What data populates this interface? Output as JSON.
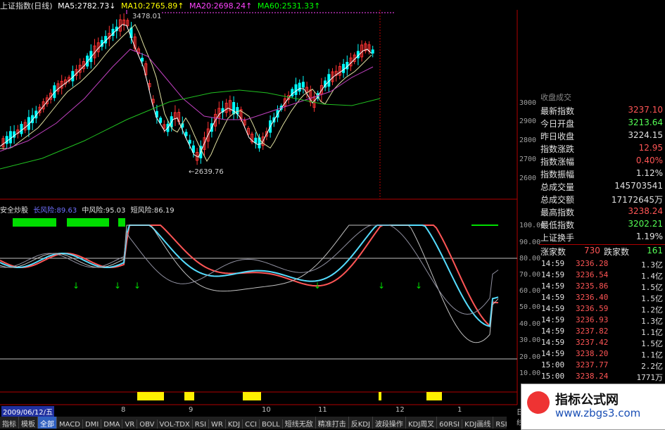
{
  "top_header": {
    "index_name": "上证指数(日线)",
    "ma5": "MA5:2782.73↓",
    "ma10": "MA10:2765.89↑",
    "ma20": "MA20:2698.24↑",
    "ma60": "MA60:2531.33↑"
  },
  "price_axis": [
    "3000",
    "2900",
    "2800",
    "2700",
    "2600"
  ],
  "annotations": {
    "high": "3478.01",
    "low": "←2639.76"
  },
  "mid_header": {
    "name": "安全炒股",
    "long_risk": "长风险:89.63",
    "mid_risk": "中风险:95.03",
    "short_risk": "短风险:86.19"
  },
  "osc_axis": [
    "100.00",
    "90.00",
    "80.00",
    "70.00",
    "60.00",
    "50.00",
    "40.00",
    "30.00",
    "20.00",
    "10.00"
  ],
  "quote": {
    "top_partial": "收盘成交",
    "rows": [
      {
        "label": "最新指数",
        "value": "3237.10",
        "color": "#ff5555"
      },
      {
        "label": "今日开盘",
        "value": "3213.64",
        "color": "#55ff55"
      },
      {
        "label": "昨日收盘",
        "value": "3224.15",
        "color": "#e0e0e0"
      },
      {
        "label": "指数涨跌",
        "value": "12.95",
        "color": "#ff5555"
      },
      {
        "label": "指数涨幅",
        "value": "0.40%",
        "color": "#ff5555"
      },
      {
        "label": "指数振幅",
        "value": "1.12%",
        "color": "#e0e0e0"
      },
      {
        "label": "总成交量",
        "value": "145703541",
        "color": "#e0e0e0"
      },
      {
        "label": "总成交额",
        "value": "17172645万",
        "color": "#e0e0e0"
      },
      {
        "label": "最高指数",
        "value": "3238.24",
        "color": "#ff5555"
      },
      {
        "label": "最低指数",
        "value": "3202.21",
        "color": "#55ff55"
      },
      {
        "label": "上证换手",
        "value": "1.19%",
        "color": "#e0e0e0"
      }
    ],
    "breadth": {
      "up_label": "涨家数",
      "up": "730",
      "down_label": "跌家数",
      "down": "161"
    },
    "ticks": [
      {
        "time": "14:59",
        "price": "3236.28",
        "vol": "1.3亿"
      },
      {
        "time": "14:59",
        "price": "3236.54",
        "vol": "1.4亿"
      },
      {
        "time": "14:59",
        "price": "3235.86",
        "vol": "1.5亿"
      },
      {
        "time": "14:59",
        "price": "3236.40",
        "vol": "1.5亿"
      },
      {
        "time": "14:59",
        "price": "3236.59",
        "vol": "1.2亿"
      },
      {
        "time": "14:59",
        "price": "3236.93",
        "vol": "1.3亿"
      },
      {
        "time": "14:59",
        "price": "3237.82",
        "vol": "1.1亿"
      },
      {
        "time": "14:59",
        "price": "3237.42",
        "vol": "1.5亿"
      },
      {
        "time": "14:59",
        "price": "3238.20",
        "vol": "1.1亿"
      },
      {
        "time": "15:00",
        "price": "3237.77",
        "vol": "2.2亿"
      },
      {
        "time": "15:00",
        "price": "3238.24",
        "vol": "1771万"
      }
    ]
  },
  "x_axis": {
    "date": "2009/06/12/五",
    "months": [
      "8",
      "9",
      "10",
      "11",
      "12",
      "1"
    ],
    "right": "日线"
  },
  "tabs": [
    "指标",
    "模板",
    "全部",
    "MACD",
    "DMI",
    "DMA",
    "VR",
    "OBV",
    "VOL-TDX",
    "RSI",
    "WR",
    "KDJ",
    "CCI",
    "BOLL",
    "短线无敌",
    "精准打击",
    "反KDJ",
    "波段操作",
    "KDJ周叉",
    "60RSI",
    "KDJ画线",
    "RSI趋势"
  ],
  "active_tab": "全部",
  "watermark": {
    "title": "指标公式网",
    "url": "www.zbgs3.com"
  },
  "colors": {
    "up": "#ff3333",
    "down": "#00ffff",
    "ma5": "#ffffff",
    "ma10": "#ffff00",
    "ma20": "#ff44ff",
    "ma60": "#00ff00"
  }
}
